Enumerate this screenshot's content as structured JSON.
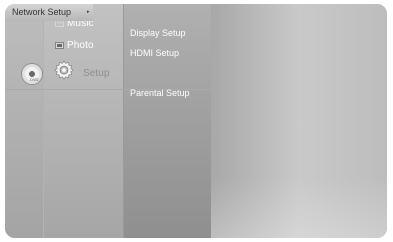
{
  "main_menu": {
    "items": [
      {
        "label": "Music",
        "icon": "music-icon"
      },
      {
        "label": "Photo",
        "icon": "photo-icon"
      },
      {
        "label": "Setup",
        "icon": "gear-icon",
        "selected": true
      }
    ]
  },
  "sub_menu": {
    "items": [
      {
        "label": "Display Setup"
      },
      {
        "label": "HDMI Setup"
      },
      {
        "label": "Network Setup",
        "highlighted": true
      },
      {
        "label": "Parental Setup"
      }
    ]
  },
  "disc": {
    "label": "DVD"
  },
  "colors": {
    "text": "#ffffff",
    "highlight": "#d0d0d0",
    "selected_text": "#8d8d8d"
  }
}
